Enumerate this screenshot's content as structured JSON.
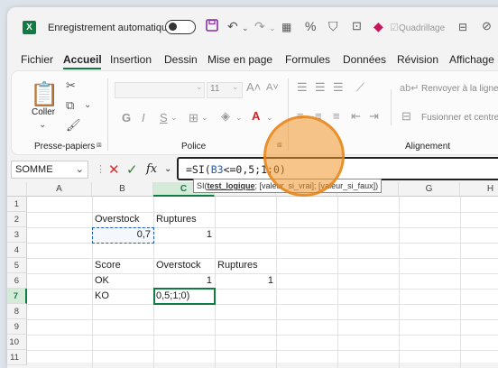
{
  "titlebar": {
    "app_logo": "X",
    "autosave_label": "Enregistrement automatique",
    "autosave_state": "Désactivé",
    "gridlines_label": "Quadrillage",
    "icons": [
      "save-icon",
      "undo-icon",
      "redo-icon",
      "table-icon",
      "percent-icon",
      "filter-icon",
      "frame-icon",
      "eraser-icon",
      "gridlines-checkbox",
      "view-icon",
      "hide-icon"
    ]
  },
  "menu": {
    "items": [
      "Fichier",
      "Accueil",
      "Insertion",
      "Dessin",
      "Mise en page",
      "Formules",
      "Données",
      "Révision",
      "Affichage"
    ],
    "active": "Accueil"
  },
  "ribbon": {
    "clipboard": {
      "paste_label": "Coller",
      "group_label": "Presse-papiers"
    },
    "font": {
      "size": "11",
      "bold": "G",
      "italic": "I",
      "underline": "S",
      "group_label": "Police"
    },
    "alignment": {
      "wrap_label": "Renvoyer à la ligne a",
      "merge_label": "Fusionner et centrer",
      "group_label": "Alignement"
    }
  },
  "formula_bar": {
    "name_box": "SOMME",
    "fx": "fx",
    "formula_prefix": "=SI(",
    "formula_ref": "B3",
    "formula_suffix": "<=0,5;1;0)"
  },
  "hint": {
    "fn": "SI(",
    "arg1": "test_logique",
    "rest": "; [valeur_si_vrai]; [valeur_si_faux])"
  },
  "sheet": {
    "columns": [
      "A",
      "B",
      "C",
      "D",
      "E",
      "F",
      "G",
      "H"
    ],
    "rows": [
      "1",
      "2",
      "3",
      "4",
      "5",
      "6",
      "7",
      "8",
      "9",
      "10",
      "11"
    ],
    "cells": {
      "B2": "Overstock",
      "C2": "Ruptures",
      "B3": "0,7",
      "C3": "1",
      "B5": "Score",
      "C5": "Overstock",
      "D5": "Ruptures",
      "B6": "OK",
      "C6": "1",
      "D6": "1",
      "B7": "KO",
      "C7": "0,5;1;0)"
    }
  },
  "colors": {
    "excel_green": "#107c41",
    "ref_blue": "#1f5fbf",
    "highlight_orange": "#f0962a"
  }
}
